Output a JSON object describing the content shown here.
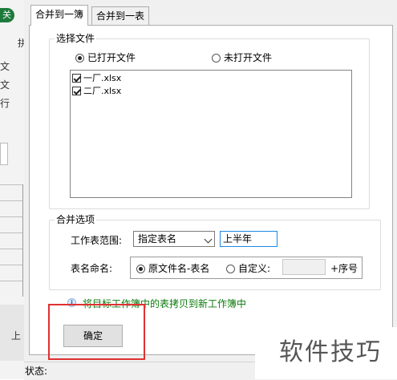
{
  "background_app": {
    "badge_text": "关",
    "ribbon_chars": [
      "拼",
      "文",
      "文",
      "行"
    ],
    "sheet_tab_char": "上"
  },
  "tabs": [
    {
      "label": "合并到一簿",
      "active": true
    },
    {
      "label": "合并到一表",
      "active": false
    }
  ],
  "select_files": {
    "title": "选择文件",
    "option_open": "已打开文件",
    "option_unopened": "未打开文件",
    "selected": "open",
    "files": [
      {
        "name": "一厂.xlsx",
        "checked": true
      },
      {
        "name": "二厂.xlsx",
        "checked": true
      }
    ]
  },
  "merge_options": {
    "title": "合并选项",
    "range_label": "工作表范围:",
    "range_value": "指定表名",
    "sheet_name_value": "上半年",
    "naming_label": "表名命名:",
    "naming_option1": "原文件名-表名",
    "naming_option2": "自定义:",
    "custom_value": "",
    "suffix_label": "+序号"
  },
  "hint_text": "将目标工作簿中的表拷贝到新工作簿中",
  "ok_button": "确定",
  "status_label": "状态:",
  "watermark_text": "软件技巧",
  "colors": {
    "highlight": "#e03131",
    "hint_green": "#0a7a0a",
    "badge_green": "#1e7a3c",
    "textbox_focus": "#1e88e5"
  }
}
